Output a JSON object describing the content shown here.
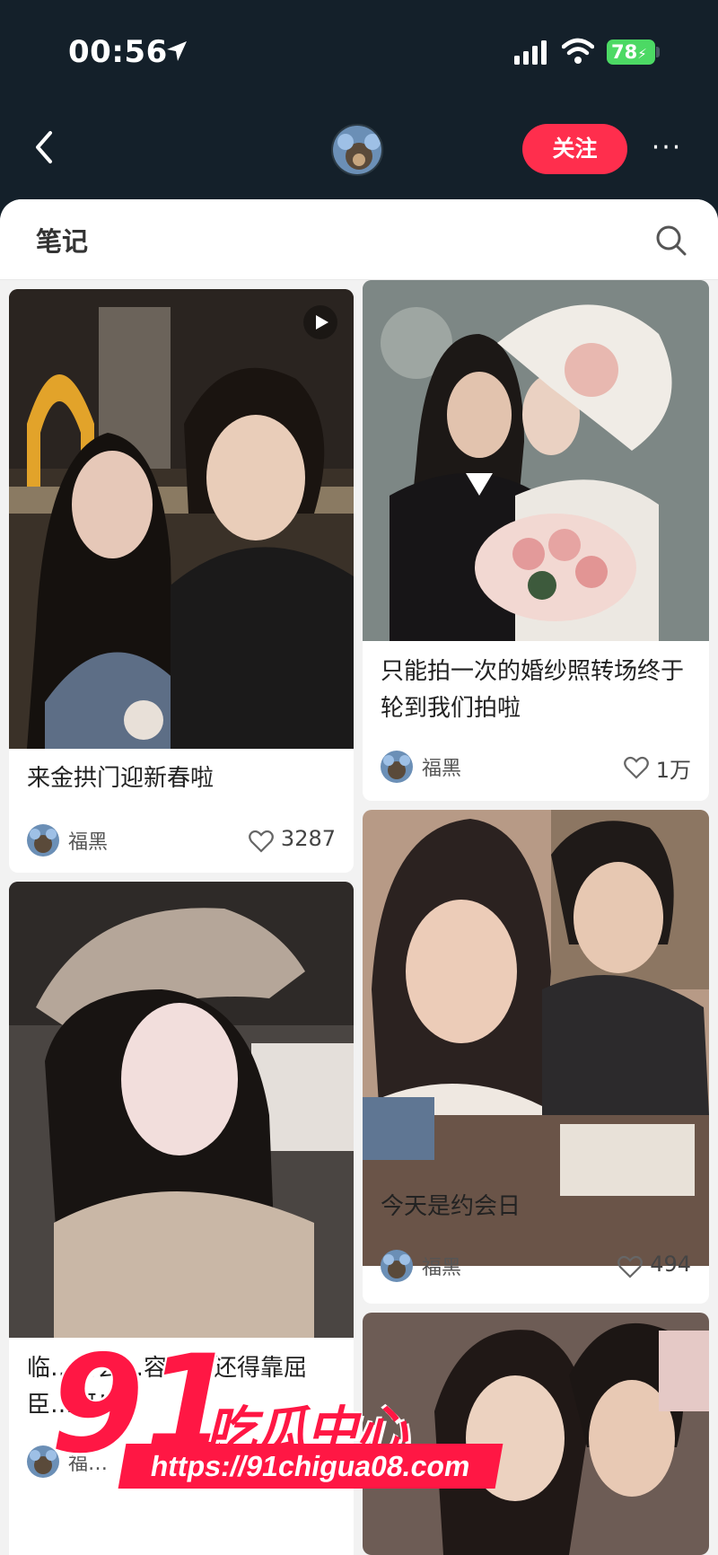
{
  "status_bar": {
    "time": "00:56",
    "battery": "78"
  },
  "nav": {
    "follow_label": "关注",
    "more_label": "···"
  },
  "panel": {
    "title": "笔记"
  },
  "cards": [
    {
      "title": "来金拱门迎新春啦",
      "author": "福黑",
      "likes": "3287",
      "has_video": true
    },
    {
      "title": "只能拍一次的婚纱照转场终于轮到我们拍啦",
      "author": "福黑",
      "likes": "1万",
      "has_video": false
    },
    {
      "title": "临…约会…容…成还得靠屈臣…呀！",
      "author": "福…",
      "likes": "",
      "has_video": false
    },
    {
      "title": "今天是约会日",
      "author": "福黑",
      "likes": "494",
      "has_video": false
    }
  ],
  "watermark": {
    "brand_number": "91",
    "brand_name": "吃瓜中心",
    "url": "https://91chigua08.com"
  },
  "colors": {
    "accent": "#ff2e4d",
    "header_bg": "#14202a",
    "panel_bg": "#f2f2f2"
  }
}
